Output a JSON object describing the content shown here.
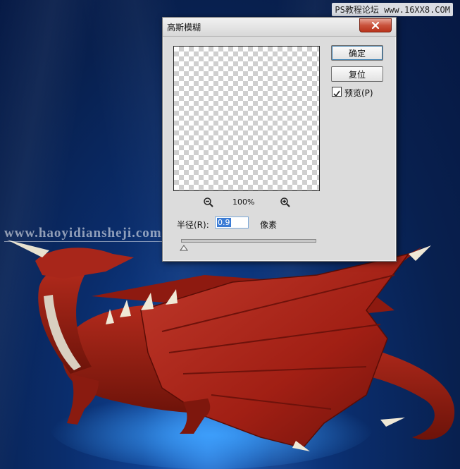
{
  "watermarks": {
    "top_right": "PS教程论坛 www.16XX8.COM",
    "center_left": "www.haoyidiansheji.com"
  },
  "dialog": {
    "title": "高斯模糊",
    "zoom_percent": "100%",
    "radius_label": "半径(R):",
    "radius_value": "0.9",
    "unit_label": "像素",
    "slider_position": 0.0,
    "buttons": {
      "ok": "确定",
      "reset": "复位"
    },
    "preview_checkbox": {
      "label": "预览(P)",
      "checked": true
    }
  },
  "icons": {
    "close": "close-icon",
    "zoom_out": "zoom-out-icon",
    "zoom_in": "zoom-in-icon",
    "checkmark": "checkmark-icon",
    "slider_thumb": "slider-thumb-icon"
  },
  "colors": {
    "close_button": "#c9523b",
    "background_blue": "#0a2d6c",
    "dragon_red": "#a11f14",
    "selection": "#3a7bd5"
  }
}
